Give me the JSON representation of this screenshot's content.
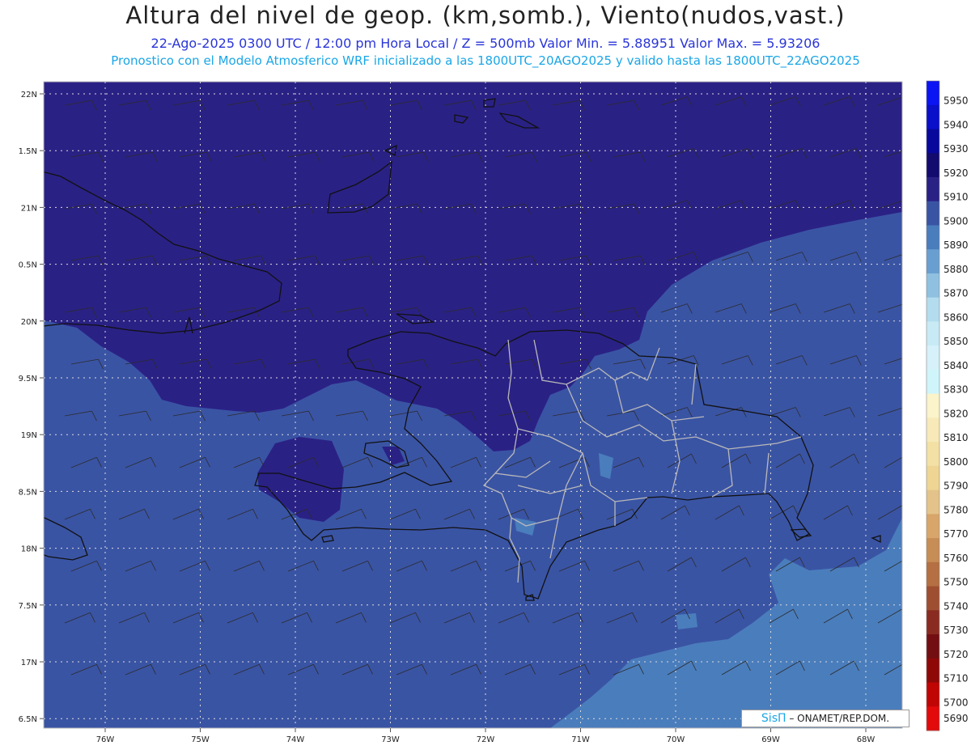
{
  "titles": {
    "main": "Altura del nivel de geop. (km,somb.), Viento(nudos,vast.)",
    "line2": "22-Ago-2025  0300 UTC / 12:00 pm Hora Local / Z = 500mb     Valor Min. = 5.88951   Valor Max. = 5.93206",
    "line3": "Pronostico con el Modelo Atmosferico WRF inicializado a las 1800UTC_20AGO2025 y valido hasta las  1800UTC_22AGO2025"
  },
  "map": {
    "lat_labels": [
      "22N",
      "1.5N",
      "21N",
      "0.5N",
      "20N",
      "9.5N",
      "19N",
      "8.5N",
      "18N",
      "7.5N",
      "17N",
      "6.5N"
    ],
    "lon_labels": [
      "76W",
      "75W",
      "74W",
      "73W",
      "72W",
      "71W",
      "70W",
      "69W",
      "68W"
    ],
    "colors": {
      "deep": "#2a2185",
      "mid": "#3a54a4",
      "light": "#4a7dbc",
      "coast": "#111111",
      "border": "#b9b9b9"
    }
  },
  "colorbar": {
    "levels": [
      "5950",
      "5940",
      "5930",
      "5920",
      "5910",
      "5900",
      "5890",
      "5880",
      "5870",
      "5860",
      "5850",
      "5840",
      "5830",
      "5820",
      "5810",
      "5800",
      "5790",
      "5780",
      "5770",
      "5760",
      "5750",
      "5740",
      "5730",
      "5720",
      "5710",
      "5700",
      "5690"
    ],
    "colors": [
      "#0b14f2",
      "#0a0fc9",
      "#08099c",
      "#130b6e",
      "#2a2185",
      "#3a54a4",
      "#4a7dbc",
      "#699fd0",
      "#8fc0df",
      "#b3dcee",
      "#c8eaf5",
      "#d6f1f9",
      "#cff5fb",
      "#fbf3c9",
      "#f7eab8",
      "#f3e0a4",
      "#efd594",
      "#e4c38a",
      "#d8a66a",
      "#c68d56",
      "#b46f42",
      "#9f4f31",
      "#8a2b22",
      "#730f12",
      "#8f0808",
      "#c00505",
      "#e20a0a"
    ]
  },
  "credit": {
    "logo": "SisΠ",
    "text": "– ONAMET/REP.DOM."
  }
}
